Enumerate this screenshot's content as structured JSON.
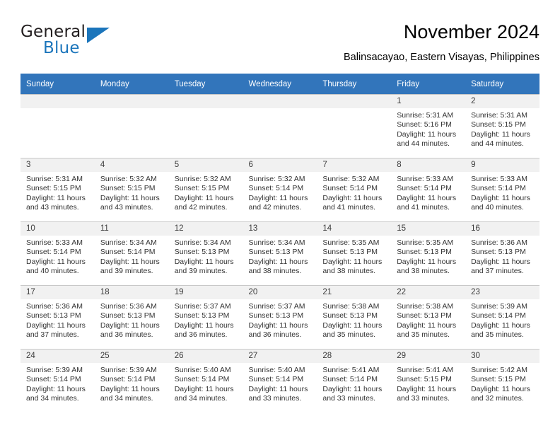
{
  "brand": {
    "name_part1": "General",
    "name_part2": "Blue",
    "triangle_color": "#1b75bb",
    "text_color": "#231f20"
  },
  "header": {
    "title": "November 2024",
    "subtitle": "Balinsacayao, Eastern Visayas, Philippines"
  },
  "theme": {
    "header_row_bg": "#3275bb",
    "header_row_text": "#ffffff",
    "daynum_band_bg": "#f1f1f1",
    "cell_text": "#333333",
    "grid_line": "#c8c8c8"
  },
  "weekdays": [
    "Sunday",
    "Monday",
    "Tuesday",
    "Wednesday",
    "Thursday",
    "Friday",
    "Saturday"
  ],
  "weeks": [
    [
      {
        "day": "",
        "sunrise": "",
        "sunset": "",
        "daylight_line1": "",
        "daylight_line2": ""
      },
      {
        "day": "",
        "sunrise": "",
        "sunset": "",
        "daylight_line1": "",
        "daylight_line2": ""
      },
      {
        "day": "",
        "sunrise": "",
        "sunset": "",
        "daylight_line1": "",
        "daylight_line2": ""
      },
      {
        "day": "",
        "sunrise": "",
        "sunset": "",
        "daylight_line1": "",
        "daylight_line2": ""
      },
      {
        "day": "",
        "sunrise": "",
        "sunset": "",
        "daylight_line1": "",
        "daylight_line2": ""
      },
      {
        "day": "1",
        "sunrise": "Sunrise: 5:31 AM",
        "sunset": "Sunset: 5:16 PM",
        "daylight_line1": "Daylight: 11 hours",
        "daylight_line2": "and 44 minutes."
      },
      {
        "day": "2",
        "sunrise": "Sunrise: 5:31 AM",
        "sunset": "Sunset: 5:15 PM",
        "daylight_line1": "Daylight: 11 hours",
        "daylight_line2": "and 44 minutes."
      }
    ],
    [
      {
        "day": "3",
        "sunrise": "Sunrise: 5:31 AM",
        "sunset": "Sunset: 5:15 PM",
        "daylight_line1": "Daylight: 11 hours",
        "daylight_line2": "and 43 minutes."
      },
      {
        "day": "4",
        "sunrise": "Sunrise: 5:32 AM",
        "sunset": "Sunset: 5:15 PM",
        "daylight_line1": "Daylight: 11 hours",
        "daylight_line2": "and 43 minutes."
      },
      {
        "day": "5",
        "sunrise": "Sunrise: 5:32 AM",
        "sunset": "Sunset: 5:15 PM",
        "daylight_line1": "Daylight: 11 hours",
        "daylight_line2": "and 42 minutes."
      },
      {
        "day": "6",
        "sunrise": "Sunrise: 5:32 AM",
        "sunset": "Sunset: 5:14 PM",
        "daylight_line1": "Daylight: 11 hours",
        "daylight_line2": "and 42 minutes."
      },
      {
        "day": "7",
        "sunrise": "Sunrise: 5:32 AM",
        "sunset": "Sunset: 5:14 PM",
        "daylight_line1": "Daylight: 11 hours",
        "daylight_line2": "and 41 minutes."
      },
      {
        "day": "8",
        "sunrise": "Sunrise: 5:33 AM",
        "sunset": "Sunset: 5:14 PM",
        "daylight_line1": "Daylight: 11 hours",
        "daylight_line2": "and 41 minutes."
      },
      {
        "day": "9",
        "sunrise": "Sunrise: 5:33 AM",
        "sunset": "Sunset: 5:14 PM",
        "daylight_line1": "Daylight: 11 hours",
        "daylight_line2": "and 40 minutes."
      }
    ],
    [
      {
        "day": "10",
        "sunrise": "Sunrise: 5:33 AM",
        "sunset": "Sunset: 5:14 PM",
        "daylight_line1": "Daylight: 11 hours",
        "daylight_line2": "and 40 minutes."
      },
      {
        "day": "11",
        "sunrise": "Sunrise: 5:34 AM",
        "sunset": "Sunset: 5:14 PM",
        "daylight_line1": "Daylight: 11 hours",
        "daylight_line2": "and 39 minutes."
      },
      {
        "day": "12",
        "sunrise": "Sunrise: 5:34 AM",
        "sunset": "Sunset: 5:13 PM",
        "daylight_line1": "Daylight: 11 hours",
        "daylight_line2": "and 39 minutes."
      },
      {
        "day": "13",
        "sunrise": "Sunrise: 5:34 AM",
        "sunset": "Sunset: 5:13 PM",
        "daylight_line1": "Daylight: 11 hours",
        "daylight_line2": "and 38 minutes."
      },
      {
        "day": "14",
        "sunrise": "Sunrise: 5:35 AM",
        "sunset": "Sunset: 5:13 PM",
        "daylight_line1": "Daylight: 11 hours",
        "daylight_line2": "and 38 minutes."
      },
      {
        "day": "15",
        "sunrise": "Sunrise: 5:35 AM",
        "sunset": "Sunset: 5:13 PM",
        "daylight_line1": "Daylight: 11 hours",
        "daylight_line2": "and 38 minutes."
      },
      {
        "day": "16",
        "sunrise": "Sunrise: 5:36 AM",
        "sunset": "Sunset: 5:13 PM",
        "daylight_line1": "Daylight: 11 hours",
        "daylight_line2": "and 37 minutes."
      }
    ],
    [
      {
        "day": "17",
        "sunrise": "Sunrise: 5:36 AM",
        "sunset": "Sunset: 5:13 PM",
        "daylight_line1": "Daylight: 11 hours",
        "daylight_line2": "and 37 minutes."
      },
      {
        "day": "18",
        "sunrise": "Sunrise: 5:36 AM",
        "sunset": "Sunset: 5:13 PM",
        "daylight_line1": "Daylight: 11 hours",
        "daylight_line2": "and 36 minutes."
      },
      {
        "day": "19",
        "sunrise": "Sunrise: 5:37 AM",
        "sunset": "Sunset: 5:13 PM",
        "daylight_line1": "Daylight: 11 hours",
        "daylight_line2": "and 36 minutes."
      },
      {
        "day": "20",
        "sunrise": "Sunrise: 5:37 AM",
        "sunset": "Sunset: 5:13 PM",
        "daylight_line1": "Daylight: 11 hours",
        "daylight_line2": "and 36 minutes."
      },
      {
        "day": "21",
        "sunrise": "Sunrise: 5:38 AM",
        "sunset": "Sunset: 5:13 PM",
        "daylight_line1": "Daylight: 11 hours",
        "daylight_line2": "and 35 minutes."
      },
      {
        "day": "22",
        "sunrise": "Sunrise: 5:38 AM",
        "sunset": "Sunset: 5:13 PM",
        "daylight_line1": "Daylight: 11 hours",
        "daylight_line2": "and 35 minutes."
      },
      {
        "day": "23",
        "sunrise": "Sunrise: 5:39 AM",
        "sunset": "Sunset: 5:14 PM",
        "daylight_line1": "Daylight: 11 hours",
        "daylight_line2": "and 35 minutes."
      }
    ],
    [
      {
        "day": "24",
        "sunrise": "Sunrise: 5:39 AM",
        "sunset": "Sunset: 5:14 PM",
        "daylight_line1": "Daylight: 11 hours",
        "daylight_line2": "and 34 minutes."
      },
      {
        "day": "25",
        "sunrise": "Sunrise: 5:39 AM",
        "sunset": "Sunset: 5:14 PM",
        "daylight_line1": "Daylight: 11 hours",
        "daylight_line2": "and 34 minutes."
      },
      {
        "day": "26",
        "sunrise": "Sunrise: 5:40 AM",
        "sunset": "Sunset: 5:14 PM",
        "daylight_line1": "Daylight: 11 hours",
        "daylight_line2": "and 34 minutes."
      },
      {
        "day": "27",
        "sunrise": "Sunrise: 5:40 AM",
        "sunset": "Sunset: 5:14 PM",
        "daylight_line1": "Daylight: 11 hours",
        "daylight_line2": "and 33 minutes."
      },
      {
        "day": "28",
        "sunrise": "Sunrise: 5:41 AM",
        "sunset": "Sunset: 5:14 PM",
        "daylight_line1": "Daylight: 11 hours",
        "daylight_line2": "and 33 minutes."
      },
      {
        "day": "29",
        "sunrise": "Sunrise: 5:41 AM",
        "sunset": "Sunset: 5:15 PM",
        "daylight_line1": "Daylight: 11 hours",
        "daylight_line2": "and 33 minutes."
      },
      {
        "day": "30",
        "sunrise": "Sunrise: 5:42 AM",
        "sunset": "Sunset: 5:15 PM",
        "daylight_line1": "Daylight: 11 hours",
        "daylight_line2": "and 32 minutes."
      }
    ]
  ]
}
